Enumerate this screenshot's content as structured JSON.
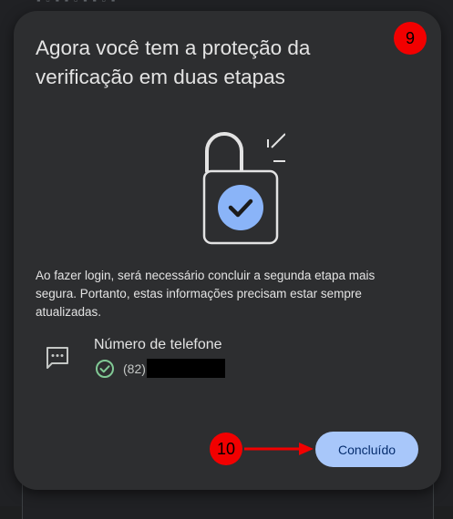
{
  "dialog": {
    "title": "Agora você tem a proteção da verificação em duas etapas",
    "illustration_icon": "padlock-check-icon",
    "description": "Ao fazer login, será necessário concluir a segunda etapa mais segura. Portanto, estas informações precisam estar sempre atualizadas.",
    "phone": {
      "icon": "sms-message-icon",
      "label": "Número de telefone",
      "status_icon": "verified-check-circle-icon",
      "prefix": "(82)"
    },
    "done_button": "Concluído"
  },
  "annotations": {
    "badge_top": "9",
    "badge_bottom": "10"
  },
  "colors": {
    "dialog_bg": "#2d2e30",
    "accent_blue": "#a8c7fa",
    "check_blue": "#8ab4f8",
    "verified_green": "#81c995",
    "badge_red": "#f20000"
  }
}
